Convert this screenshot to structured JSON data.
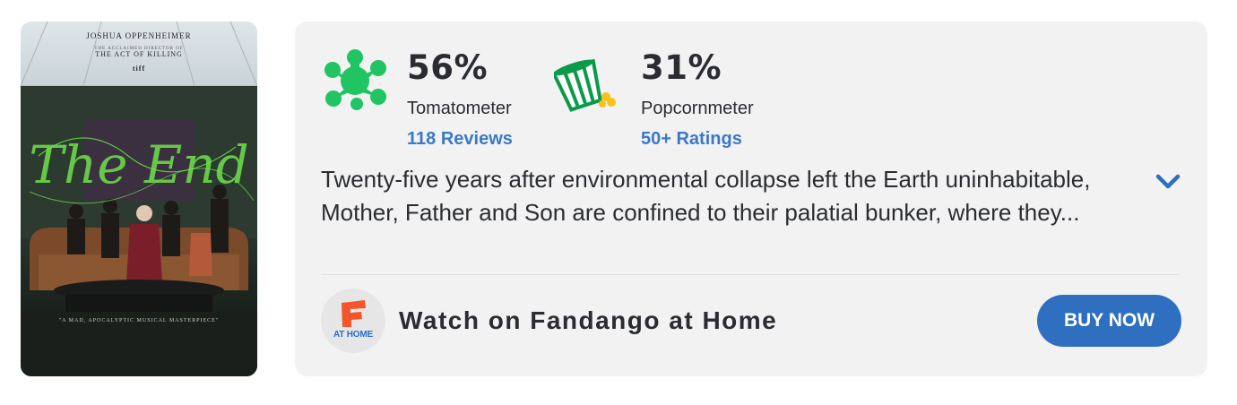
{
  "poster": {
    "director": "JOSHUA OPPENHEIMER",
    "previous_work_tagline": "THE ACCLAIMED DIRECTOR OF",
    "previous_work": "THE ACT OF KILLING",
    "festival_logo": "tiff",
    "title": "The End",
    "quote": "\"A MAD, APOCALYPTIC MUSICAL MASTERPIECE\""
  },
  "tomatometer": {
    "score": "56%",
    "label": "Tomatometer",
    "reviews_link": "118 Reviews",
    "icon": "splat-icon",
    "color": "#21c463"
  },
  "popcornmeter": {
    "score": "31%",
    "label": "Popcornmeter",
    "ratings_link": "50+ Ratings",
    "icon": "spilled-popcorn-icon",
    "color": "#0a9a4a"
  },
  "synopsis": {
    "text": "Twenty-five years after environmental collapse left the Earth uninhabitable, Mother, Father and Son are confined to their palatial bunker, where they...",
    "expand_icon": "chevron-down-icon"
  },
  "watch": {
    "logo_text": "AT HOME",
    "title": "Watch on Fandango at Home",
    "button_label": "BUY NOW",
    "button_color": "#2f6fbf"
  }
}
